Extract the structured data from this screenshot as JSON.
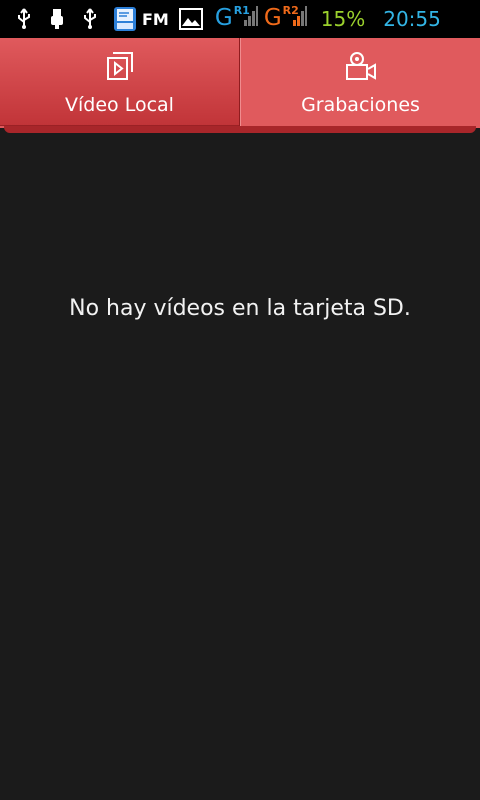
{
  "status_bar": {
    "icons": [
      "usb-icon",
      "usb-debug-icon",
      "usb-icon",
      "sd-card-icon",
      "image-icon"
    ],
    "fm_label": "FM",
    "sim1": {
      "network": "G",
      "badge": "R1",
      "color": "#27a0e0"
    },
    "sim2": {
      "network": "G",
      "badge": "R2",
      "color": "#f06a1a"
    },
    "battery": "15%",
    "time": "20:55"
  },
  "tabs": [
    {
      "label": "Vídeo Local",
      "icon": "local-video-icon",
      "selected": true
    },
    {
      "label": "Grabaciones",
      "icon": "record-camera-icon",
      "selected": false
    }
  ],
  "content": {
    "empty_message": "No hay vídeos en la tarjeta SD."
  },
  "colors": {
    "tab_bar": "#e05a5d",
    "tab_selected": "#c13438",
    "background": "#1b1b1b"
  }
}
